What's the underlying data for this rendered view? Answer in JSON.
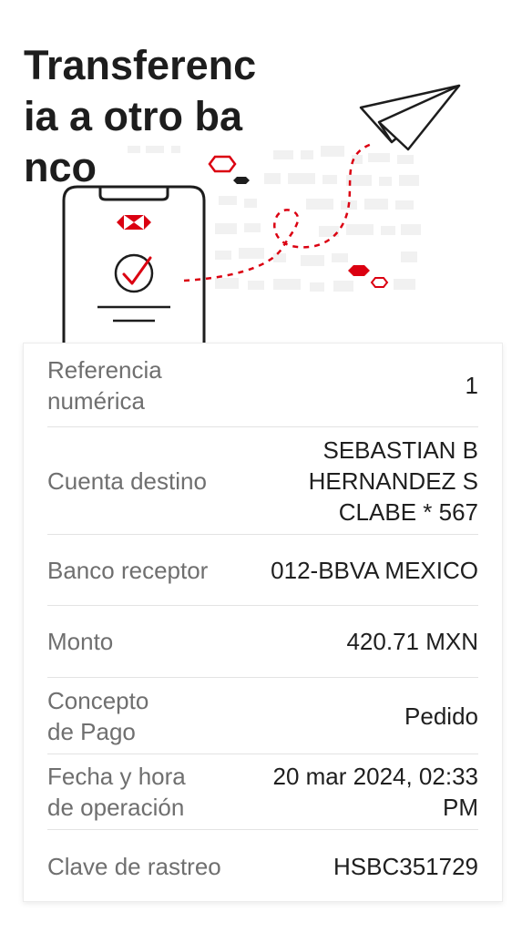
{
  "header": {
    "title": "Transferencia a otro banco"
  },
  "illustration": {
    "phone_icon": "hsbc-logo-icon",
    "check_icon": "check-circle-icon",
    "plane_icon": "paper-plane-icon",
    "accent_color": "#db0011"
  },
  "details": {
    "referencia": {
      "label": "Referencia\nnumérica",
      "value": "1"
    },
    "cuenta": {
      "label": "Cuenta destino",
      "value": "SEBASTIAN B\nHERNANDEZ S\nCLABE * 567"
    },
    "banco": {
      "label": "Banco receptor",
      "value": "012-BBVA MEXICO"
    },
    "monto": {
      "label": "Monto",
      "value": "420.71 MXN"
    },
    "concepto": {
      "label": "Concepto\nde Pago",
      "value": "Pedido"
    },
    "fecha": {
      "label": "Fecha y hora\nde operación",
      "value": "20 mar 2024, 02:33\nPM"
    },
    "clave": {
      "label": "Clave de rastreo",
      "value": "HSBC351729"
    }
  }
}
